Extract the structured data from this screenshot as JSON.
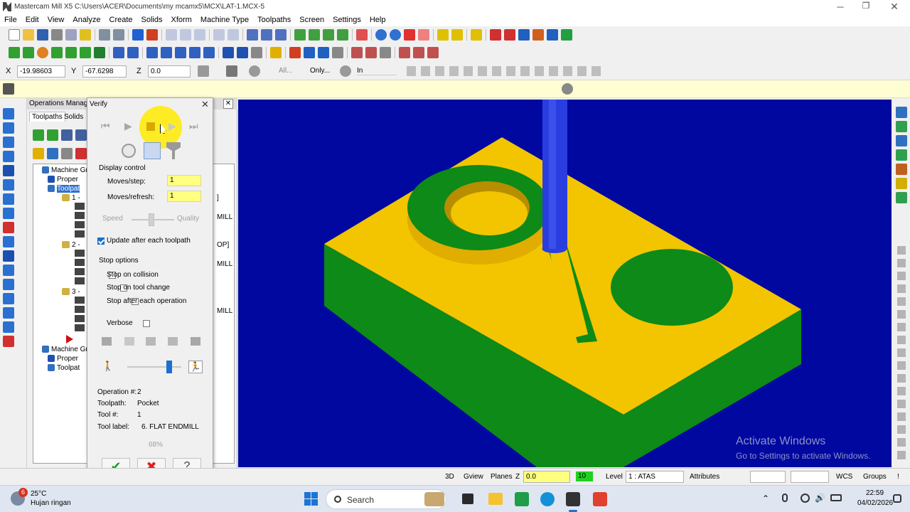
{
  "window": {
    "title": "Mastercam Mill X5  C:\\Users\\ACER\\Documents\\my mcamx5\\MCX\\LAT-1.MCX-5"
  },
  "menu": [
    "File",
    "Edit",
    "View",
    "Analyze",
    "Create",
    "Solids",
    "Xform",
    "Machine Type",
    "Toolpaths",
    "Screen",
    "Settings",
    "Help"
  ],
  "coords": {
    "x_label": "X",
    "x": "-19.98603",
    "y_label": "Y",
    "y": "-67.6298",
    "z_label": "Z",
    "z": "0.0",
    "all": "All...",
    "only": "Only...",
    "in": "In"
  },
  "ops": {
    "title": "Operations Manager",
    "tabs": [
      "Toolpaths",
      "Solids"
    ],
    "tree": [
      "Machine Gr",
      "Proper",
      "Toolpat",
      "1 -",
      "2 -",
      "3 -",
      "Machine Gr",
      "Proper",
      "Toolpat"
    ],
    "partial": [
      "]",
      "MILL",
      "OP]",
      "MILL",
      "MILL"
    ]
  },
  "verify": {
    "title": "Verify",
    "display_control": "Display control",
    "moves_step_label": "Moves/step:",
    "moves_step": "1",
    "moves_refresh_label": "Moves/refresh:",
    "moves_refresh": "1",
    "speed": "Speed",
    "quality": "Quality",
    "update_after": "Update after each toolpath",
    "stop_options": "Stop options",
    "stop_collision": "Stop on collision",
    "stop_tool_change": "Stop on tool change",
    "stop_each_op": "Stop after each operation",
    "verbose": "Verbose",
    "info": {
      "op_label": "Operation #:",
      "op": "2",
      "toolpath_label": "Toolpath:",
      "toolpath": "Pocket",
      "tool_label": "Tool #:",
      "tool": "1",
      "tool_name_label": "Tool label:",
      "tool_name": "6. FLAT ENDMILL"
    },
    "progress": "68%"
  },
  "viewport": {
    "watermark1": "Activate Windows",
    "watermark2": "Go to Settings to activate Windows."
  },
  "status": {
    "d3": "3D",
    "gview": "Gview",
    "planes": "Planes",
    "z_label": "Z",
    "z": "0.0",
    "color": "10",
    "level_label": "Level",
    "level": "1 : ATAS",
    "attributes": "Attributes",
    "wcs": "WCS",
    "groups": "Groups",
    "excl": "!"
  },
  "taskbar": {
    "temp": "25°C",
    "weather": "Hujan ringan",
    "badge": "6",
    "search": "Search",
    "time": "22:59",
    "date": "04/02/2026"
  },
  "colors": {
    "viewport_bg": "#0008a0",
    "part_top": "#f2c500",
    "part_side": "#0d8a17",
    "tool": "#2a3ee0",
    "input_yellow": "#ffff80"
  }
}
